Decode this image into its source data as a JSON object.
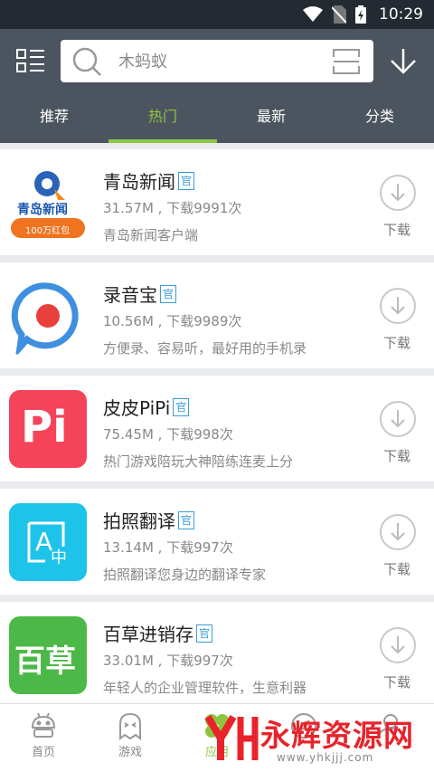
{
  "status_bar": {
    "time": "10:29",
    "icons": [
      "wifi-icon",
      "no-sim-icon",
      "battery-charging-icon"
    ]
  },
  "search": {
    "placeholder": "木蚂蚁"
  },
  "tabs": [
    {
      "label": "推荐",
      "active": false
    },
    {
      "label": "热门",
      "active": true
    },
    {
      "label": "最新",
      "active": false
    },
    {
      "label": "分类",
      "active": false
    }
  ],
  "apps": [
    {
      "name": "青岛新闻",
      "badge": "官",
      "meta": "31.57M , 下载9991次",
      "desc": "青岛新闻客户端",
      "download_label": "下载",
      "icon_text": "青岛新闻",
      "icon_subtext": "100万红包"
    },
    {
      "name": "录音宝",
      "badge": "官",
      "meta": "10.56M , 下载9989次",
      "desc": "方便录、容易听，最好用的手机录",
      "download_label": "下载"
    },
    {
      "name": "皮皮PiPi",
      "badge": "官",
      "meta": "75.45M , 下载998次",
      "desc": "热门游戏陪玩大神陪练连麦上分",
      "download_label": "下载",
      "icon_text": "Pi"
    },
    {
      "name": "拍照翻译",
      "badge": "官",
      "meta": "13.14M , 下载997次",
      "desc": "拍照翻译您身边的翻译专家",
      "download_label": "下载",
      "icon_text": "A",
      "icon_subtext": "中"
    },
    {
      "name": "百草进销存",
      "badge": "官",
      "meta": "33.01M , 下载997次",
      "desc": "年轻人的企业管理软件，生意利器",
      "download_label": "下载",
      "icon_text": "百草"
    }
  ],
  "bottom_nav": [
    {
      "label": "首页",
      "icon": "robot-icon",
      "active": false
    },
    {
      "label": "游戏",
      "icon": "ghost-icon",
      "active": false
    },
    {
      "label": "应用",
      "icon": "clover-icon",
      "active": true
    },
    {
      "label": "",
      "icon": "compass-icon",
      "active": false
    },
    {
      "label": "",
      "icon": "user-icon",
      "active": false
    }
  ],
  "watermark": {
    "text": "永辉资源网",
    "url": "www.yhkjjj.com"
  },
  "colors": {
    "accent": "#8cc63f",
    "header": "#4c555f",
    "status_bar": "#242a31",
    "badge": "#3a9bd8"
  }
}
